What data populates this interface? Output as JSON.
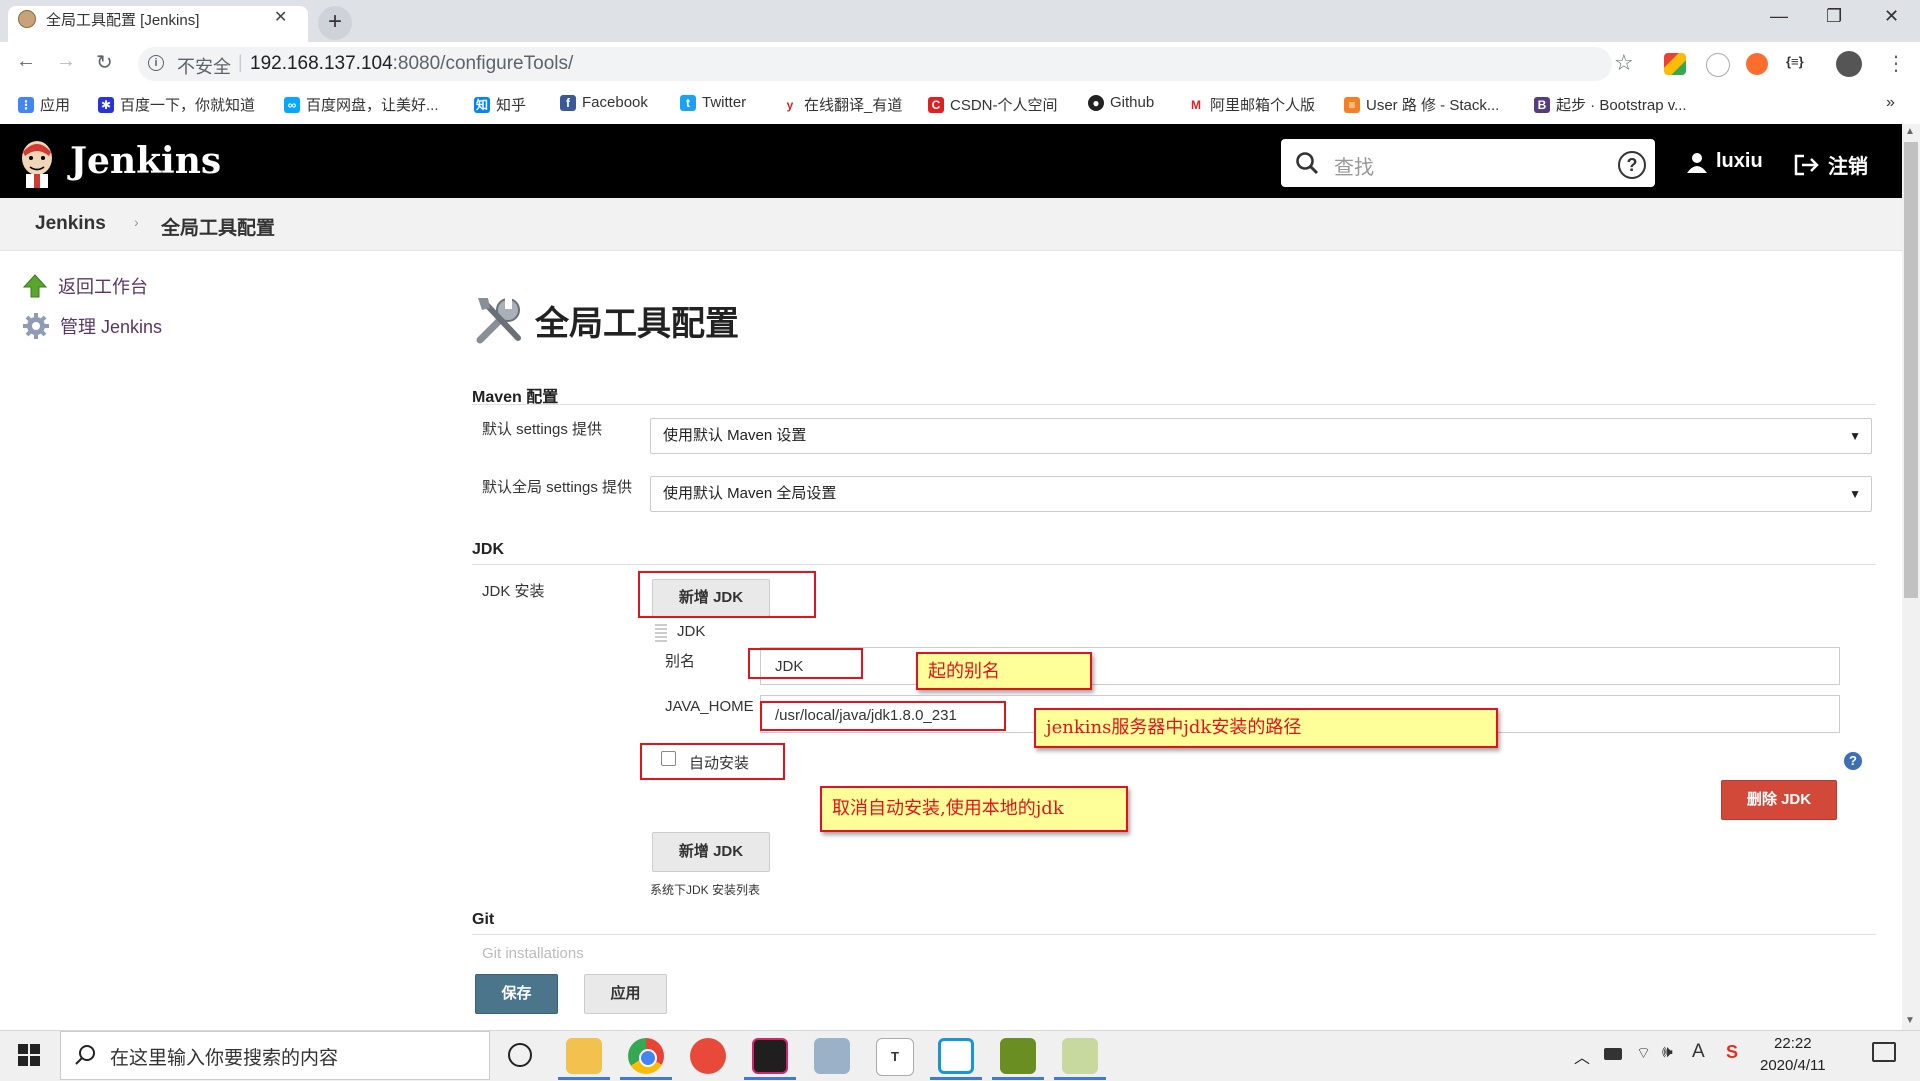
{
  "browser": {
    "tab_title": "全局工具配置 [Jenkins]",
    "new_tab": "+",
    "insecure_label": "不安全",
    "url_host": "192.168.137.104",
    "url_path": ":8080/configureTools/",
    "bookmarks": [
      "应用",
      "百度一下，你就知道",
      "百度网盘，让美好...",
      "知乎",
      "Facebook",
      "Twitter",
      "在线翻译_有道",
      "CSDN-个人空间",
      "Github",
      "阿里邮箱个人版",
      "User 路 修 - Stack...",
      "起步 · Bootstrap v..."
    ],
    "bookmarks_more": "»"
  },
  "header": {
    "title": "Jenkins",
    "search_placeholder": "查找",
    "user": "luxiu",
    "logout": "注销"
  },
  "breadcrumbs": [
    "Jenkins",
    "全局工具配置"
  ],
  "sidebar": {
    "items": [
      {
        "label": "返回工作台"
      },
      {
        "label": "管理 Jenkins"
      }
    ]
  },
  "main": {
    "title": "全局工具配置",
    "maven": {
      "title": "Maven 配置",
      "settings_label": "默认 settings 提供",
      "settings_value": "使用默认 Maven 设置",
      "global_settings_label": "默认全局 settings 提供",
      "global_settings_value": "使用默认 Maven 全局设置"
    },
    "jdk": {
      "title": "JDK",
      "install_label": "JDK 安装",
      "add_button": "新增 JDK",
      "item_header": "JDK",
      "alias_label": "别名",
      "alias_value": "JDK",
      "java_home_label": "JAVA_HOME",
      "java_home_value": "/usr/local/java/jdk1.8.0_231",
      "auto_install_label": "自动安装",
      "auto_install_checked": false,
      "delete_button": "删除 JDK",
      "add_button_2": "新增 JDK",
      "list_hint": "系统下JDK 安装列表"
    },
    "git": {
      "title": "Git",
      "partial_text": "Git installations"
    },
    "save_button": "保存",
    "apply_button": "应用"
  },
  "annotations": {
    "alias_note": "起的别名",
    "java_home_note": "jenkins服务器中jdk安装的路径",
    "auto_install_note": "取消自动安装,使用本地的jdk"
  },
  "taskbar": {
    "search_placeholder": "在这里输入你要搜索的内容",
    "time": "22:22",
    "date": "2020/4/11"
  },
  "colors": {
    "header_bg": "#000000",
    "delete_button": "#d24939",
    "save_button": "#4b758b",
    "annotation_border": "#e0141e",
    "annotation_fill": "#ffff99"
  }
}
